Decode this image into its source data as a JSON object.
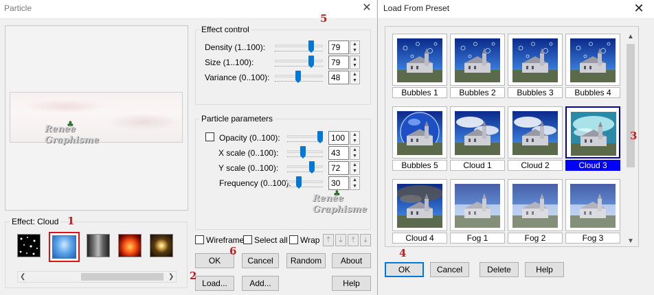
{
  "particle": {
    "title": "Particle",
    "effect_control": {
      "label": "Effect control",
      "rows": [
        {
          "label": "Density (1..100):",
          "value": "79",
          "level": 0.79
        },
        {
          "label": "Size (1..100):",
          "value": "79",
          "level": 0.79
        },
        {
          "label": "Variance (0..100):",
          "value": "48",
          "level": 0.48
        }
      ]
    },
    "particle_params": {
      "label": "Particle parameters",
      "rows": [
        {
          "label": "Opacity (0..100):",
          "value": "100",
          "level": 1.0
        },
        {
          "label": "X scale (0..100):",
          "value": "43",
          "level": 0.43
        },
        {
          "label": "Y scale (0..100):",
          "value": "72",
          "level": 0.72
        },
        {
          "label": "Frequency (0..100):",
          "value": "30",
          "level": 0.3
        }
      ]
    },
    "effect_group": {
      "label": "Effect: Cloud"
    },
    "effects": [
      "snow",
      "cloud",
      "smoke",
      "fire",
      "sparkle"
    ],
    "options": {
      "wireframe": "Wireframe",
      "select_all": "Select all",
      "wrap": "Wrap"
    },
    "buttons": {
      "ok": "OK",
      "cancel": "Cancel",
      "random": "Random",
      "about": "About",
      "load": "Load...",
      "add": "Add...",
      "help": "Help"
    },
    "watermark": {
      "line1": "Renee",
      "line2": "Graphisme"
    },
    "step_markers": {
      "one": "1",
      "two": "2",
      "five": "5",
      "six": "6"
    }
  },
  "preset": {
    "title": "Load From Preset",
    "items": [
      {
        "label": "Bubbles 1",
        "kind": "bubbles"
      },
      {
        "label": "Bubbles 2",
        "kind": "bubbles"
      },
      {
        "label": "Bubbles 3",
        "kind": "bubbles"
      },
      {
        "label": "Bubbles 4",
        "kind": "bubbles"
      },
      {
        "label": "Bubbles 5",
        "kind": "globe"
      },
      {
        "label": "Cloud 1",
        "kind": "cloud"
      },
      {
        "label": "Cloud 2",
        "kind": "cloud"
      },
      {
        "label": "Cloud 3",
        "kind": "cloud3",
        "selected": true
      },
      {
        "label": "Cloud 4",
        "kind": "dark"
      },
      {
        "label": "Fog 1",
        "kind": "fog"
      },
      {
        "label": "Fog 2",
        "kind": "fog"
      },
      {
        "label": "Fog 3",
        "kind": "fog"
      }
    ],
    "buttons": {
      "ok": "OK",
      "cancel": "Cancel",
      "delete": "Delete",
      "help": "Help"
    },
    "step_markers": {
      "three": "3",
      "four": "4"
    }
  },
  "colors": {
    "accent": "#0078d7",
    "selected": "#0000ff",
    "marker": "#bb2222"
  }
}
